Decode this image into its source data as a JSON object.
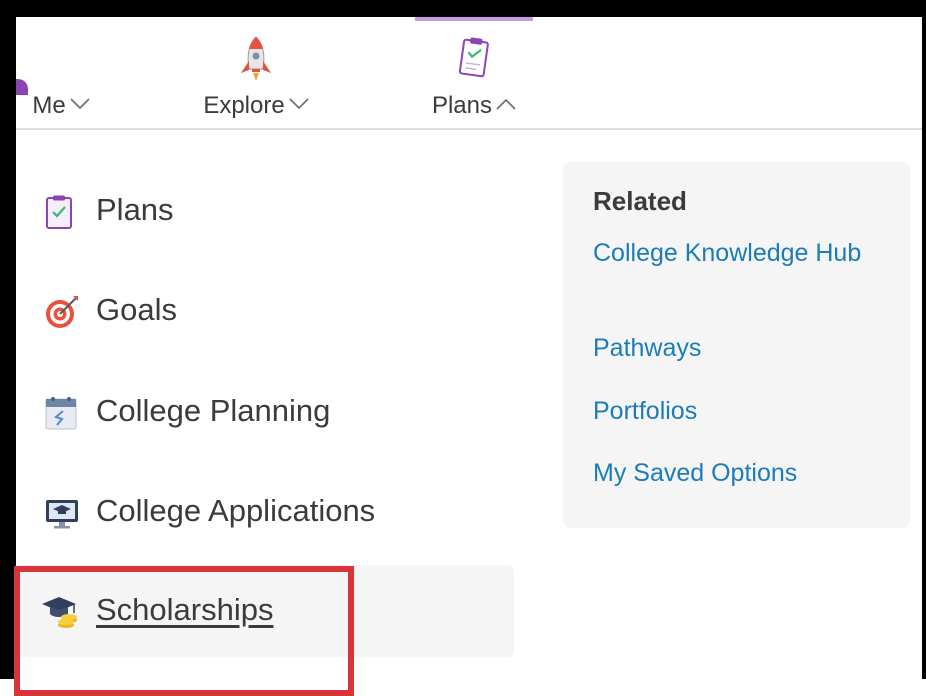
{
  "topnav": {
    "items": [
      {
        "label": "Me",
        "icon": "user-avatar-icon",
        "expanded": false
      },
      {
        "label": "Explore",
        "icon": "rocket-icon",
        "expanded": false
      },
      {
        "label": "Plans",
        "icon": "clipboard-check-icon",
        "expanded": true
      }
    ]
  },
  "menu": {
    "items": [
      {
        "label": "Plans",
        "icon": "clipboard-check-icon"
      },
      {
        "label": "Goals",
        "icon": "target-icon"
      },
      {
        "label": "College Planning",
        "icon": "calendar-icon"
      },
      {
        "label": "College Applications",
        "icon": "monitor-graduation-icon"
      },
      {
        "label": "Scholarships",
        "icon": "graduation-cap-coins-icon",
        "active": true
      }
    ]
  },
  "related": {
    "title": "Related",
    "links": [
      "College Knowledge Hub",
      "Pathways",
      "Portfolios",
      "My Saved Options"
    ]
  },
  "colors": {
    "accent_purple": "#8a45b5",
    "link_blue": "#1b7cb8",
    "highlight_red": "#d8343a"
  }
}
